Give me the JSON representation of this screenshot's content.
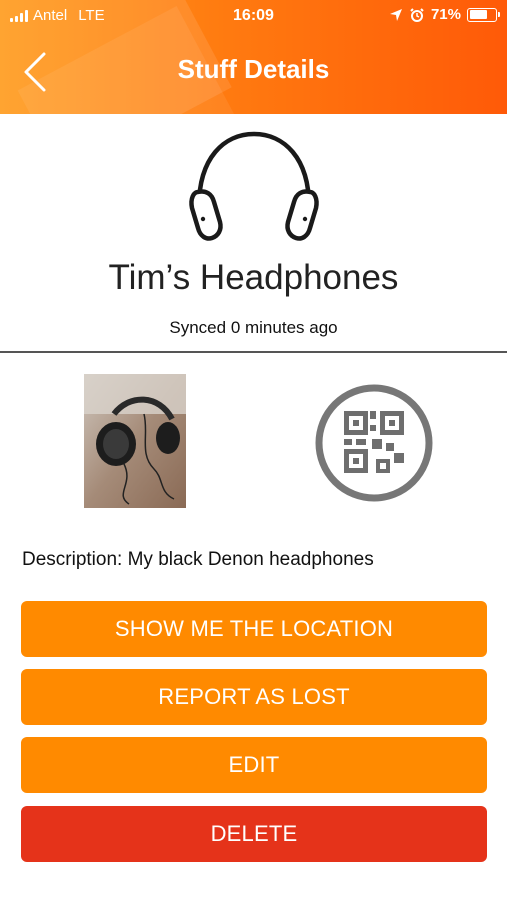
{
  "status_bar": {
    "carrier": "Antel",
    "network": "LTE",
    "time": "16:09",
    "battery_text": "71%",
    "battery_level": 0.71
  },
  "header": {
    "title": "Stuff Details",
    "back_icon": "chevron-left-icon",
    "gradient_colors": [
      "#ff9a1a",
      "#ff5a08"
    ]
  },
  "item": {
    "icon": "headphones-icon",
    "name": "Tim’s Headphones",
    "sync_status": "Synced 0 minutes ago",
    "description": "Description: My black Denon headphones"
  },
  "qr_icon": "qr-code-icon",
  "actions": {
    "show_location": "SHOW ME THE LOCATION",
    "report_lost": "REPORT AS LOST",
    "edit": "EDIT",
    "delete": "DELETE"
  },
  "colors": {
    "primary": "#ff8a00",
    "danger": "#e5331a"
  }
}
